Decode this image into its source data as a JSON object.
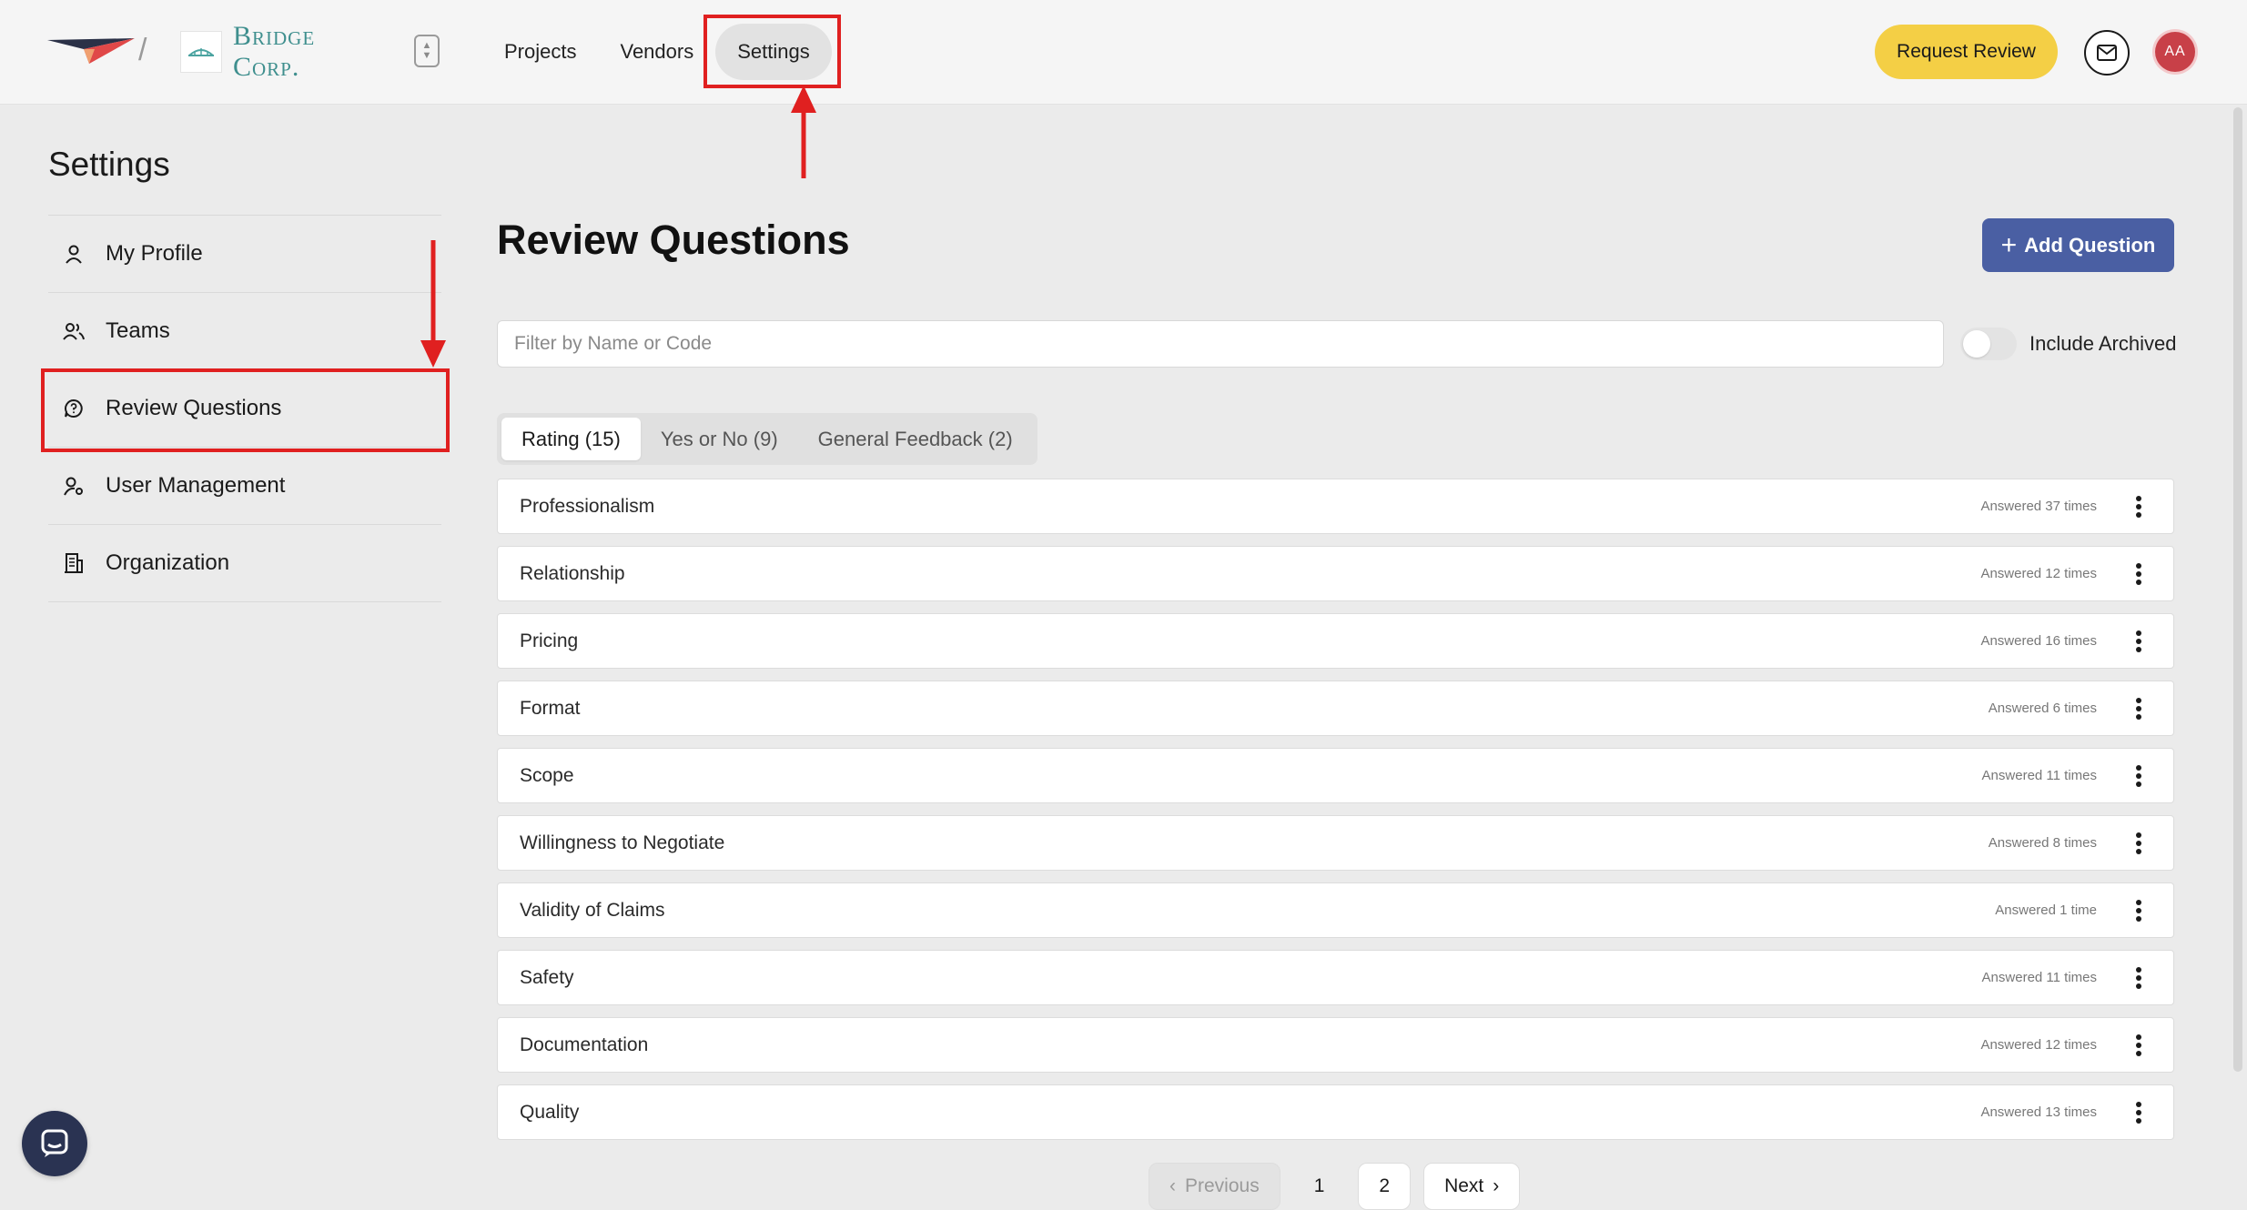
{
  "header": {
    "separator": "/",
    "brand_name": "Bridge Corp.",
    "nav": [
      {
        "label": "Projects"
      },
      {
        "label": "Vendors"
      },
      {
        "label": "Settings",
        "active": true
      }
    ],
    "request_review_label": "Request Review",
    "avatar_initials": "AA"
  },
  "sidebar": {
    "title": "Settings",
    "items": [
      {
        "label": "My Profile",
        "icon": "user-icon"
      },
      {
        "label": "Teams",
        "icon": "users-icon"
      },
      {
        "label": "Review Questions",
        "icon": "question-bubble-icon",
        "active": true
      },
      {
        "label": "User Management",
        "icon": "user-gear-icon"
      },
      {
        "label": "Organization",
        "icon": "building-icon"
      }
    ]
  },
  "main": {
    "title": "Review Questions",
    "add_button_label": "Add Question",
    "filter_placeholder": "Filter by Name or Code",
    "filter_value": "",
    "include_archived_label": "Include Archived",
    "include_archived": false,
    "tabs": [
      {
        "label": "Rating (15)",
        "active": true
      },
      {
        "label": "Yes or No (9)"
      },
      {
        "label": "General Feedback (2)"
      }
    ],
    "questions": [
      {
        "name": "Professionalism",
        "answered": "Answered 37 times"
      },
      {
        "name": "Relationship",
        "answered": "Answered 12 times"
      },
      {
        "name": "Pricing",
        "answered": "Answered 16 times"
      },
      {
        "name": "Format",
        "answered": "Answered 6 times"
      },
      {
        "name": "Scope",
        "answered": "Answered 11 times"
      },
      {
        "name": "Willingness to Negotiate",
        "answered": "Answered 8 times"
      },
      {
        "name": "Validity of Claims",
        "answered": "Answered 1 time"
      },
      {
        "name": "Safety",
        "answered": "Answered 11 times"
      },
      {
        "name": "Documentation",
        "answered": "Answered 12 times"
      },
      {
        "name": "Quality",
        "answered": "Answered 13 times"
      }
    ],
    "pagination": {
      "previous_label": "Previous",
      "pages": [
        "1",
        "2"
      ],
      "next_label": "Next"
    }
  },
  "colors": {
    "accent_yellow": "#f4cf45",
    "primary_blue": "#4a5fa3",
    "annotation_red": "#e02020",
    "brand_teal": "#3f8f8e"
  }
}
